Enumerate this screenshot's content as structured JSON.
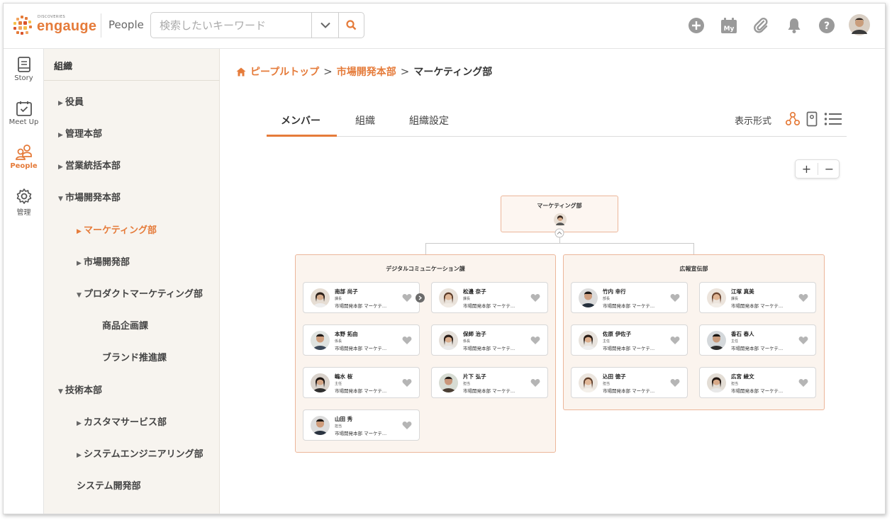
{
  "header": {
    "logo_small": "DISCOVERIES",
    "logo_word": "engauge",
    "title": "People",
    "search_placeholder": "検索したいキーワード",
    "icons": [
      "plus-circle-icon",
      "calendar-my-icon",
      "paperclip-icon",
      "bell-icon",
      "help-icon",
      "user-avatar"
    ],
    "calendar_label": "My"
  },
  "rail": {
    "items": [
      {
        "label": "Story",
        "icon": "story-icon"
      },
      {
        "label": "Meet Up",
        "icon": "calendar-check-icon"
      },
      {
        "label": "People",
        "icon": "people-icon",
        "active": true
      },
      {
        "label": "管理",
        "icon": "gear-icon"
      }
    ]
  },
  "sidebar": {
    "heading": "組織",
    "items": [
      {
        "label": "役員",
        "tri": "▶"
      },
      {
        "label": "管理本部",
        "tri": "▶"
      },
      {
        "label": "営業統括本部",
        "tri": "▶"
      },
      {
        "label": "市場開発本部",
        "tri": "▼"
      },
      {
        "label": "マーケティング部",
        "tri": "▶",
        "active": true
      },
      {
        "label": "市場開発部",
        "tri": "▶"
      },
      {
        "label": "プロダクトマーケティング部",
        "tri": "▼"
      },
      {
        "label": "商品企画課",
        "tri": ""
      },
      {
        "label": "ブランド推進課",
        "tri": ""
      },
      {
        "label": "技術本部",
        "tri": "▼"
      },
      {
        "label": "カスタマサービス部",
        "tri": "▶"
      },
      {
        "label": "システムエンジニアリング部",
        "tri": "▶"
      },
      {
        "label": "システム開発部",
        "tri": ""
      }
    ]
  },
  "breadcrumb": {
    "home": "ピープルトップ",
    "sep": ">",
    "parent": "市場開発本部",
    "current": "マーケティング部"
  },
  "tabs": {
    "items": [
      "メンバー",
      "組織",
      "組織設定"
    ],
    "active": "メンバー",
    "view_label": "表示形式"
  },
  "zoom": {
    "plus": "+",
    "minus": "−"
  },
  "colors": {
    "accent": "#e57b3a",
    "group_border": "#ecb69a",
    "group_bg": "#fbf4ee"
  },
  "org": {
    "root": "マーケティング部",
    "groups": [
      {
        "title": "デジタルコミュニケーション課",
        "members": [
          {
            "name": "南部 尚子",
            "role": "課長",
            "dept": "市場開発本部 マーケテ..."
          },
          {
            "name": "松邊 奈子",
            "role": "課長",
            "dept": "市場開発本部 マーケテ..."
          },
          {
            "name": "本野 拓由",
            "role": "係長",
            "dept": "市場開発本部 マーケテ..."
          },
          {
            "name": "保師 治子",
            "role": "係長",
            "dept": "市場開発本部 マーケテ..."
          },
          {
            "name": "嶋水 桜",
            "role": "主任",
            "dept": "市場開発本部 マーケテ..."
          },
          {
            "name": "片下 弘子",
            "role": "担当",
            "dept": "市場開発本部 マーケテ..."
          },
          {
            "name": "山田 秀",
            "role": "担当",
            "dept": "市場開発本部 マーケテ..."
          }
        ]
      },
      {
        "title": "広報宣伝部",
        "members": [
          {
            "name": "竹内 幸行",
            "role": "部長",
            "dept": "市場開発本部 マーケテ..."
          },
          {
            "name": "江塚 真美",
            "role": "課長",
            "dept": "市場開発本部 マーケテ..."
          },
          {
            "name": "佐原 伊佐子",
            "role": "主任",
            "dept": "市場開発本部 マーケテ..."
          },
          {
            "name": "香石 春人",
            "role": "主任",
            "dept": "市場開発本部 マーケテ..."
          },
          {
            "name": "込田 徳子",
            "role": "担当",
            "dept": "市場開発本部 マーケテ..."
          },
          {
            "name": "広宮 綾文",
            "role": "担当",
            "dept": "市場開発本部 マーケテ..."
          }
        ]
      }
    ]
  }
}
